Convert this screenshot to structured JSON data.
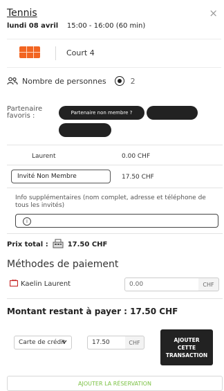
{
  "header": {
    "title": "Tennis",
    "close_symbol": "×",
    "date": "lundi 08 avril",
    "time": "15:00 - 16:00 (60 min)"
  },
  "court": {
    "label": "Court 4",
    "icon": "tennis-court-icon"
  },
  "persons": {
    "label": "Nombre de personnes",
    "count": "2"
  },
  "partners": {
    "label_line1": "Partenaire",
    "label_line2": "favoris :",
    "non_member_button": "Partenaire non membre ?",
    "partner_1": "",
    "partner_2": ""
  },
  "participants": [
    {
      "name": "Laurent",
      "price": "0.00 CHF"
    },
    {
      "name": "Invité Non Membre",
      "price": "17.50 CHF"
    }
  ],
  "info": {
    "label": "Info supplémentaires (nom complet, adresse et téléphone de tous les invités)",
    "icon_char": "i"
  },
  "total": {
    "label": "Prix total :",
    "value": "17.50 CHF"
  },
  "payment": {
    "title": "Méthodes de paiement",
    "card_holder": "Kaelin Laurent",
    "card_amount_placeholder": "0.00",
    "currency": "CHF"
  },
  "remaining": {
    "text": "Montant restant à payer : 17.50 CHF"
  },
  "transaction": {
    "method": "Carte de crédit",
    "amount": "17.50",
    "currency": "CHF",
    "add_button_line1": "AJOUTER",
    "add_button_line2": "CETTE",
    "add_button_line3": "TRANSACTION"
  },
  "footer": {
    "add_reservation": "AJOUTER LA RÉSERVATION"
  },
  "colors": {
    "court_orange": "#f26522",
    "accent_green": "#7ac142",
    "card_red": "#c62828"
  }
}
